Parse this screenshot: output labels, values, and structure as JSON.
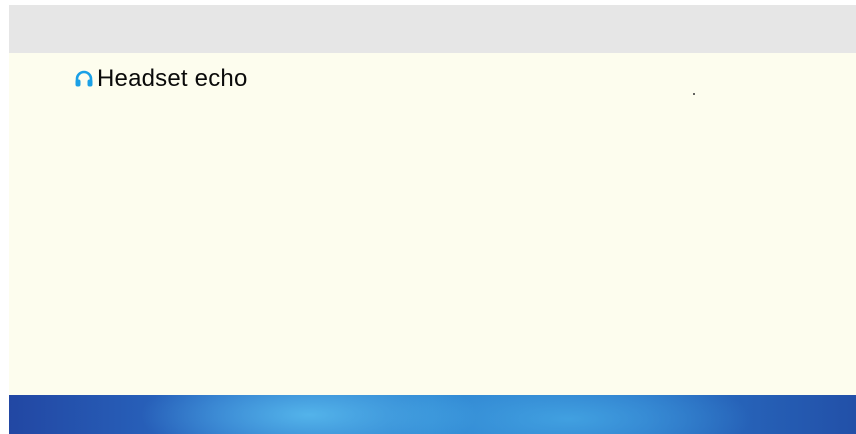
{
  "header": {
    "title": "Headset echo",
    "icon": "headset-icon",
    "icon_color": "#1aa0e6"
  },
  "colors": {
    "top_bar": "#e6e6e6",
    "content_background": "#fdfdee",
    "bottom_bar_accent": "#2f86d2"
  }
}
